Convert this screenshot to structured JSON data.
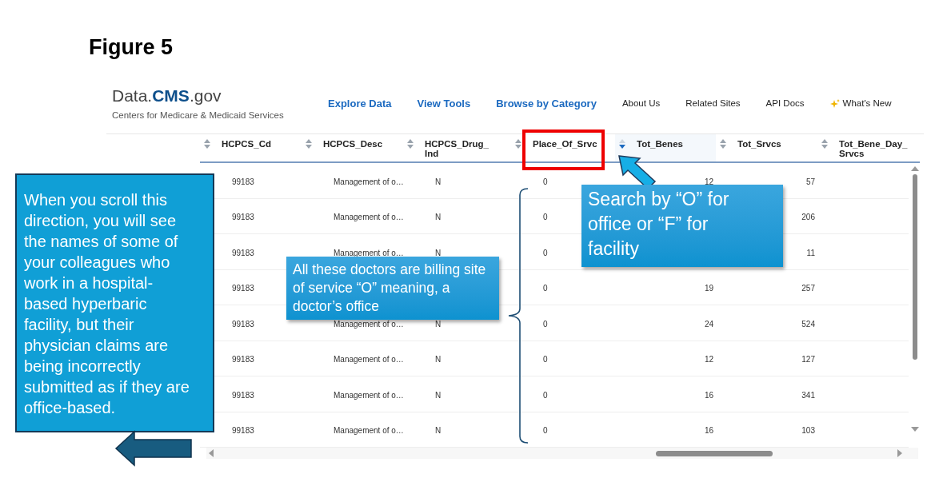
{
  "figure_title": "Figure 5",
  "header": {
    "logo": "Data.**CMS**.gov",
    "subtitle": "Centers for Medicare & Medicaid Services",
    "nav": [
      {
        "label": "Explore Data",
        "kind": "primary"
      },
      {
        "label": "View Tools",
        "kind": "primary"
      },
      {
        "label": "Browse by Category",
        "kind": "primary"
      },
      {
        "label": "About Us",
        "kind": "secondary"
      },
      {
        "label": "Related Sites",
        "kind": "secondary"
      },
      {
        "label": "API Docs",
        "kind": "secondary"
      },
      {
        "label": "What's New",
        "kind": "featured"
      }
    ]
  },
  "table": {
    "columns": [
      {
        "label": "HCPCS_Cd",
        "sorted": false,
        "kind": "text"
      },
      {
        "label": "HCPCS_Desc",
        "sorted": false,
        "kind": "text"
      },
      {
        "label": "HCPCS_Drug_ Ind",
        "sorted": false,
        "kind": "text"
      },
      {
        "label": "Place_Of_Srvc",
        "sorted": false,
        "kind": "text"
      },
      {
        "label": "Tot_Benes",
        "sorted": true,
        "kind": "number"
      },
      {
        "label": "Tot_Srvcs",
        "sorted": false,
        "kind": "number"
      },
      {
        "label": "Tot_Bene_Day_ Srvcs",
        "sorted": false
      }
    ],
    "rows": [
      {
        "cells": [
          "99183",
          "Management of o…",
          "N",
          "0",
          "12",
          "57"
        ]
      },
      {
        "cells": [
          "99183",
          "Management of o…",
          "N",
          "0",
          null,
          "206"
        ]
      },
      {
        "cells": [
          "99183",
          "Management of o…",
          "N",
          "0",
          null,
          "11"
        ]
      },
      {
        "cells": [
          "99183",
          null,
          null,
          "0",
          "19",
          "257"
        ]
      },
      {
        "cells": [
          "99183",
          "Management of o…",
          "N",
          "0",
          "24",
          "524"
        ]
      },
      {
        "cells": [
          "99183",
          "Management of o…",
          "N",
          "0",
          "12",
          "127"
        ]
      },
      {
        "cells": [
          "99183",
          "Management of o…",
          "N",
          "0",
          "16",
          "341"
        ]
      },
      {
        "cells": [
          "99183",
          "Management of o…",
          "N",
          "0",
          "16",
          "103"
        ]
      }
    ]
  },
  "callouts": {
    "scroll_note": "When you scroll this direction, you will see the names of some of your colleagues who work in a hospital-based hyperbaric facility, but their physician claims are being incorrectly submitted as if they are office-based.",
    "billing_note": "All these doctors are billing site of service “O” meaning, a doctor’s office",
    "search_note": "Search by “O” for office or “F” for facility"
  }
}
